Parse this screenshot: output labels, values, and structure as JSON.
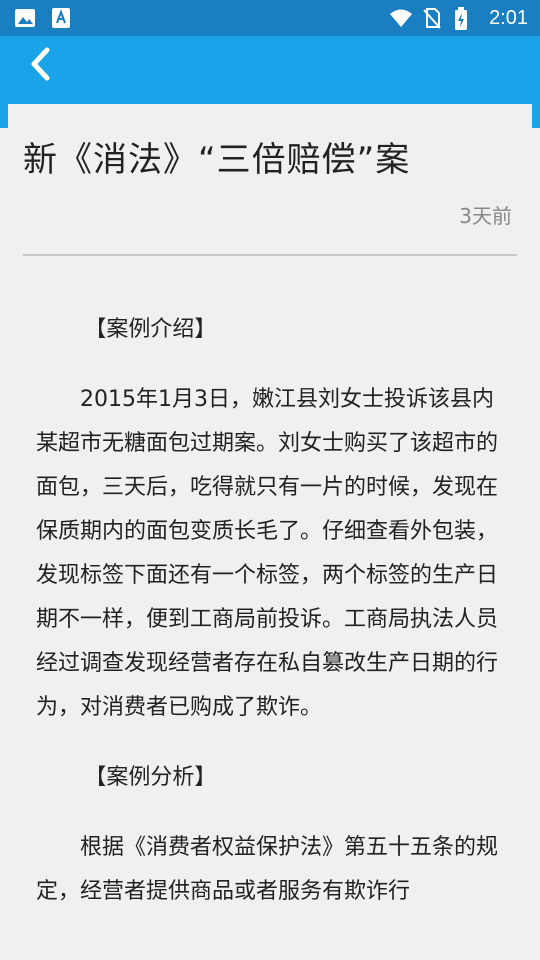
{
  "status_bar": {
    "time": "2:01",
    "icons": [
      "image-icon",
      "text-app-icon",
      "wifi-icon",
      "no-sim-icon",
      "battery-charging-icon"
    ]
  },
  "app_bar": {
    "back_icon": "chevron-left-icon",
    "color": "#1aa3e8"
  },
  "article": {
    "title": "新《消法》“三倍赔偿”案",
    "time": "3天前",
    "paragraphs": [
      "【案例介绍】",
      "2015年1月3日，嫩江县刘女士投诉该县内某超市无糖面包过期案。刘女士购买了该超市的面包，三天后，吃得就只有一片的时候，发现在保质期内的面包变质长毛了。仔细查看外包装，发现标签下面还有一个标签，两个标签的生产日期不一样，便到工商局前投诉。工商局执法人员经过调查发现经营者存在私自篡改生产日期的行为，对消费者已购成了欺诈。",
      "【案例分析】",
      "根据《消费者权益保护法》第五十五条的规定，经营者提供商品或者服务有欺诈行"
    ]
  }
}
